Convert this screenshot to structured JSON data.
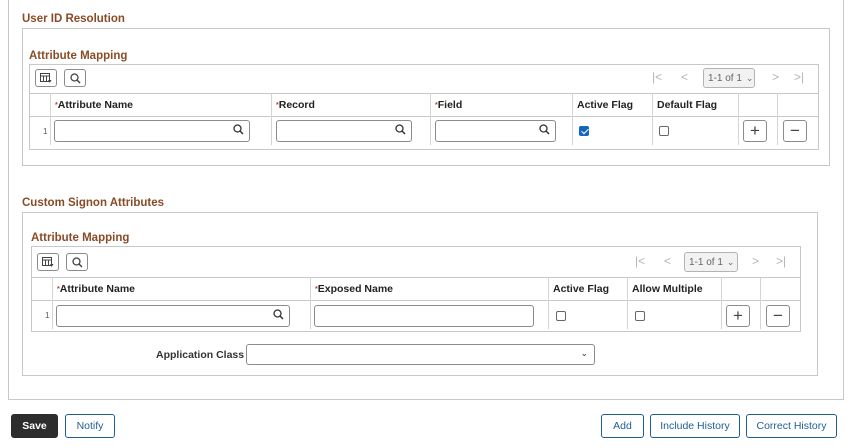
{
  "user_id_resolution": {
    "title": "User ID Resolution",
    "grid": {
      "title": "Attribute Mapping",
      "pager": {
        "range": "1-1 of 1"
      },
      "columns": [
        "Attribute Name",
        "Record",
        "Field",
        "Active Flag",
        "Default Flag"
      ],
      "rows": [
        {
          "num": "1",
          "attribute_name": "",
          "record": "",
          "field": "",
          "active_flag": true,
          "default_flag": false
        }
      ]
    }
  },
  "custom_signon": {
    "title": "Custom Signon Attributes",
    "grid": {
      "title": "Attribute Mapping",
      "pager": {
        "range": "1-1 of 1"
      },
      "columns": [
        "Attribute Name",
        "Exposed Name",
        "Active Flag",
        "Allow Multiple"
      ],
      "rows": [
        {
          "num": "1",
          "attribute_name": "",
          "exposed_name": "",
          "active_flag": false,
          "allow_multiple": false
        }
      ]
    },
    "application_class": {
      "label": "Application Class",
      "value": ""
    }
  },
  "footer": {
    "save": "Save",
    "notify": "Notify",
    "add": "Add",
    "include_history": "Include History",
    "correct_history": "Correct History"
  },
  "colors": {
    "section_title": "#8a4b27",
    "link_blue": "#1f5e95",
    "checkbox_blue": "#1565c0",
    "required_red": "#c0392b"
  },
  "icons": [
    "grid-personalize-icon",
    "find-icon",
    "first-page-icon",
    "previous-page-icon",
    "next-page-icon",
    "last-page-icon",
    "lookup-icon",
    "add-row-icon",
    "delete-row-icon",
    "chevron-down-icon"
  ]
}
